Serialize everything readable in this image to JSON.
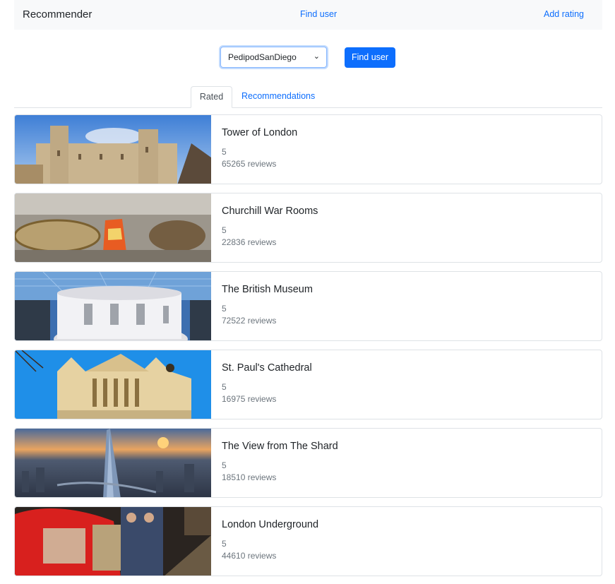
{
  "navbar": {
    "brand": "Recommender",
    "links": [
      {
        "label": "Find user"
      },
      {
        "label": "Add rating"
      }
    ]
  },
  "search": {
    "selected_user": "PedipodSanDiego",
    "button_label": "Find user"
  },
  "tabs": [
    {
      "label": "Rated",
      "active": true
    },
    {
      "label": "Recommendations",
      "active": false
    }
  ],
  "colors": {
    "accent": "#0d6efd",
    "navbar_bg": "#f8f9fa",
    "muted_text": "#6c757d"
  },
  "places": [
    {
      "title": "Tower of London",
      "rating": "5",
      "reviews": "65265 reviews",
      "image": "tower-of-london-photo"
    },
    {
      "title": "Churchill War Rooms",
      "rating": "5",
      "reviews": "22836 reviews",
      "image": "churchill-war-rooms-photo"
    },
    {
      "title": "The British Museum",
      "rating": "5",
      "reviews": "72522 reviews",
      "image": "british-museum-photo"
    },
    {
      "title": "St. Paul's Cathedral",
      "rating": "5",
      "reviews": "16975 reviews",
      "image": "st-pauls-cathedral-photo"
    },
    {
      "title": "The View from The Shard",
      "rating": "5",
      "reviews": "18510 reviews",
      "image": "shard-view-photo"
    },
    {
      "title": "London Underground",
      "rating": "5",
      "reviews": "44610 reviews",
      "image": "london-underground-photo"
    }
  ]
}
